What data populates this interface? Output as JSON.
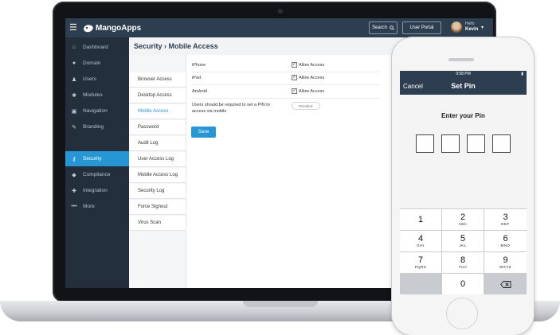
{
  "app": {
    "logo_text": "MangoApps",
    "search_label": "Search",
    "user_portal_label": "User Portal",
    "hello_label": "Hello",
    "user_name": "Kevin"
  },
  "sidebar": {
    "items": [
      {
        "label": "Dashboard",
        "icon": "home-icon"
      },
      {
        "label": "Domain",
        "icon": "globe-icon"
      },
      {
        "label": "Users",
        "icon": "user-icon"
      },
      {
        "label": "Modules",
        "icon": "modules-icon"
      },
      {
        "label": "Navigation",
        "icon": "navigation-icon"
      },
      {
        "label": "Branding",
        "icon": "brush-icon"
      },
      {
        "label": "Security",
        "icon": "key-icon",
        "active": true
      },
      {
        "label": "Compliance",
        "icon": "shield-icon"
      },
      {
        "label": "Integration",
        "icon": "wrench-icon"
      },
      {
        "label": "More",
        "icon": "more-icon"
      }
    ]
  },
  "page": {
    "title": "Security › Mobile Access"
  },
  "subnav": {
    "items": [
      "Browser Access",
      "Desktop Access",
      "Mobile Access",
      "Password",
      "Audit Log",
      "User Access Log",
      "Mobile Access Log",
      "Security Log",
      "Force Signout",
      "Virus Scan"
    ],
    "active": "Mobile Access"
  },
  "access_rows": [
    {
      "device": "iPhone",
      "check_label": "Allow Access",
      "checked": true
    },
    {
      "device": "iPad",
      "check_label": "Allow Access",
      "checked": true
    },
    {
      "device": "Android",
      "check_label": "Allow Access",
      "checked": true
    }
  ],
  "pin_setting": {
    "label": "Users should be required to set a PIN to access via mobile",
    "toggle_label": "ENABLE"
  },
  "save_label": "Save",
  "phone": {
    "time": "9:58 PM",
    "battery": "▮",
    "cancel_label": "Cancel",
    "title": "Set Pin",
    "prompt": "Enter your Pin",
    "keys": [
      {
        "num": "1",
        "letters": ""
      },
      {
        "num": "2",
        "letters": "ABC"
      },
      {
        "num": "3",
        "letters": "DEF"
      },
      {
        "num": "4",
        "letters": "GHI"
      },
      {
        "num": "5",
        "letters": "JKL"
      },
      {
        "num": "6",
        "letters": "MNO"
      },
      {
        "num": "7",
        "letters": "PQRS"
      },
      {
        "num": "8",
        "letters": "TUV"
      },
      {
        "num": "9",
        "letters": "WXYZ"
      },
      {
        "num": "0",
        "letters": ""
      }
    ]
  },
  "colors": {
    "topbar": "#2c3e50",
    "sidebar": "#232f3c",
    "accent": "#2696d4"
  }
}
